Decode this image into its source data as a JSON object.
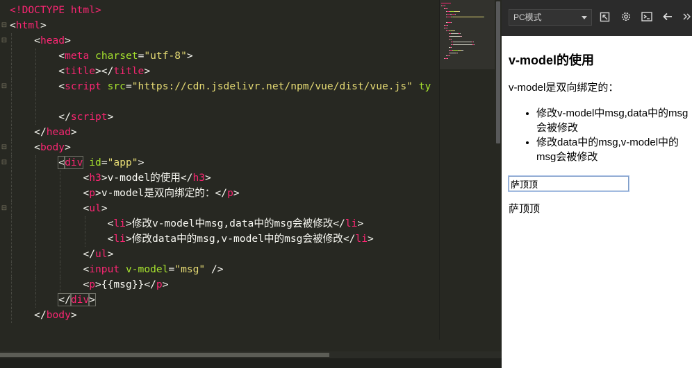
{
  "editor": {
    "lines": [
      {
        "indent": 0,
        "fold": "",
        "tokens": [
          {
            "c": "t",
            "v": "<!DOCTYPE html>"
          }
        ]
      },
      {
        "indent": 0,
        "fold": "⊟",
        "tokens": [
          {
            "c": "p",
            "v": "<"
          },
          {
            "c": "t",
            "v": "html"
          },
          {
            "c": "p",
            "v": ">"
          }
        ]
      },
      {
        "indent": 1,
        "fold": "⊟",
        "tokens": [
          {
            "c": "p",
            "v": "<"
          },
          {
            "c": "t",
            "v": "head"
          },
          {
            "c": "p",
            "v": ">"
          }
        ]
      },
      {
        "indent": 2,
        "fold": "",
        "tokens": [
          {
            "c": "p",
            "v": "<"
          },
          {
            "c": "t",
            "v": "meta"
          },
          {
            "c": "p",
            "v": " "
          },
          {
            "c": "a",
            "v": "charset"
          },
          {
            "c": "p",
            "v": "="
          },
          {
            "c": "s",
            "v": "\"utf-8\""
          },
          {
            "c": "p",
            "v": ">"
          }
        ]
      },
      {
        "indent": 2,
        "fold": "",
        "tokens": [
          {
            "c": "p",
            "v": "<"
          },
          {
            "c": "t",
            "v": "title"
          },
          {
            "c": "p",
            "v": "></"
          },
          {
            "c": "t",
            "v": "title"
          },
          {
            "c": "p",
            "v": ">"
          }
        ]
      },
      {
        "indent": 2,
        "fold": "⊟",
        "tokens": [
          {
            "c": "p",
            "v": "<"
          },
          {
            "c": "t",
            "v": "script"
          },
          {
            "c": "p",
            "v": " "
          },
          {
            "c": "a",
            "v": "src"
          },
          {
            "c": "p",
            "v": "="
          },
          {
            "c": "s",
            "v": "\"https://cdn.jsdelivr.net/npm/vue/dist/vue.js\""
          },
          {
            "c": "p",
            "v": " "
          },
          {
            "c": "a",
            "v": "ty"
          }
        ]
      },
      {
        "indent": 2,
        "fold": "",
        "tokens": []
      },
      {
        "indent": 2,
        "fold": "",
        "tokens": [
          {
            "c": "p",
            "v": "</"
          },
          {
            "c": "t",
            "v": "script"
          },
          {
            "c": "p",
            "v": ">"
          }
        ]
      },
      {
        "indent": 1,
        "fold": "",
        "tokens": [
          {
            "c": "p",
            "v": "</"
          },
          {
            "c": "t",
            "v": "head"
          },
          {
            "c": "p",
            "v": ">"
          }
        ]
      },
      {
        "indent": 1,
        "fold": "⊟",
        "tokens": [
          {
            "c": "p",
            "v": "<"
          },
          {
            "c": "t",
            "v": "body"
          },
          {
            "c": "p",
            "v": ">"
          }
        ]
      },
      {
        "indent": 2,
        "fold": "⊟",
        "tokens": [
          {
            "c": "p h",
            "v": "<"
          },
          {
            "c": "t h",
            "v": "div"
          },
          {
            "c": "p",
            "v": " "
          },
          {
            "c": "a",
            "v": "id"
          },
          {
            "c": "p",
            "v": "="
          },
          {
            "c": "s",
            "v": "\"app\""
          },
          {
            "c": "p",
            "v": ">"
          }
        ]
      },
      {
        "indent": 3,
        "fold": "",
        "tokens": [
          {
            "c": "p",
            "v": "<"
          },
          {
            "c": "t",
            "v": "h3"
          },
          {
            "c": "p",
            "v": ">v-model的使用</"
          },
          {
            "c": "t",
            "v": "h3"
          },
          {
            "c": "p",
            "v": ">"
          }
        ]
      },
      {
        "indent": 3,
        "fold": "",
        "tokens": [
          {
            "c": "p",
            "v": "<"
          },
          {
            "c": "t",
            "v": "p"
          },
          {
            "c": "p",
            "v": ">v-model是双向绑定的：</"
          },
          {
            "c": "t",
            "v": "p"
          },
          {
            "c": "p",
            "v": ">"
          }
        ]
      },
      {
        "indent": 3,
        "fold": "⊟",
        "tokens": [
          {
            "c": "p",
            "v": "<"
          },
          {
            "c": "t",
            "v": "ul"
          },
          {
            "c": "p",
            "v": ">"
          }
        ]
      },
      {
        "indent": 4,
        "fold": "",
        "tokens": [
          {
            "c": "p",
            "v": "<"
          },
          {
            "c": "t",
            "v": "li"
          },
          {
            "c": "p",
            "v": ">修改v-model中msg,data中的msg会被修改</"
          },
          {
            "c": "t",
            "v": "li"
          },
          {
            "c": "p",
            "v": ">"
          }
        ]
      },
      {
        "indent": 4,
        "fold": "",
        "tokens": [
          {
            "c": "p",
            "v": "<"
          },
          {
            "c": "t",
            "v": "li"
          },
          {
            "c": "p",
            "v": ">修改data中的msg,v-model中的msg会被修改</"
          },
          {
            "c": "t",
            "v": "li"
          },
          {
            "c": "p",
            "v": ">"
          }
        ]
      },
      {
        "indent": 3,
        "fold": "",
        "tokens": [
          {
            "c": "p",
            "v": "</"
          },
          {
            "c": "t",
            "v": "ul"
          },
          {
            "c": "p",
            "v": ">"
          }
        ]
      },
      {
        "indent": 3,
        "fold": "",
        "tokens": [
          {
            "c": "p",
            "v": "<"
          },
          {
            "c": "t",
            "v": "input"
          },
          {
            "c": "p",
            "v": " "
          },
          {
            "c": "a",
            "v": "v-model"
          },
          {
            "c": "p",
            "v": "="
          },
          {
            "c": "s",
            "v": "\"msg\""
          },
          {
            "c": "p",
            "v": " />"
          }
        ]
      },
      {
        "indent": 3,
        "fold": "",
        "tokens": [
          {
            "c": "p",
            "v": "<"
          },
          {
            "c": "t",
            "v": "p"
          },
          {
            "c": "p",
            "v": ">{{msg}}</"
          },
          {
            "c": "t",
            "v": "p"
          },
          {
            "c": "p",
            "v": ">"
          }
        ]
      },
      {
        "indent": 2,
        "fold": "",
        "tokens": [
          {
            "c": "p h",
            "v": "</"
          },
          {
            "c": "t h",
            "v": "div"
          },
          {
            "c": "p h",
            "v": ">"
          }
        ]
      },
      {
        "indent": 1,
        "fold": "",
        "tokens": [
          {
            "c": "p",
            "v": "</"
          },
          {
            "c": "t",
            "v": "body"
          },
          {
            "c": "p",
            "v": ">"
          }
        ]
      },
      {
        "indent": 0,
        "fold": "",
        "tokens": []
      }
    ]
  },
  "preview": {
    "mode": "PC模式",
    "toolbar_icons": [
      "popout-icon",
      "gear-icon",
      "terminal-icon",
      "back-arrow-icon",
      "double-chevron-icon"
    ],
    "heading": "v-model的使用",
    "description": "v-model是双向绑定的：",
    "items": [
      "修改v-model中msg,data中的msg会被修改",
      "修改data中的msg,v-model中的msg会被修改"
    ],
    "input_value": "萨顶顶",
    "output_text": "萨顶顶"
  },
  "colors": {
    "editor_bg": "#272822",
    "tag": "#f92672",
    "attr": "#a6e22e",
    "string": "#e6db74",
    "text": "#f8f8f2",
    "preview_toolbar": "#2b2b2b"
  }
}
